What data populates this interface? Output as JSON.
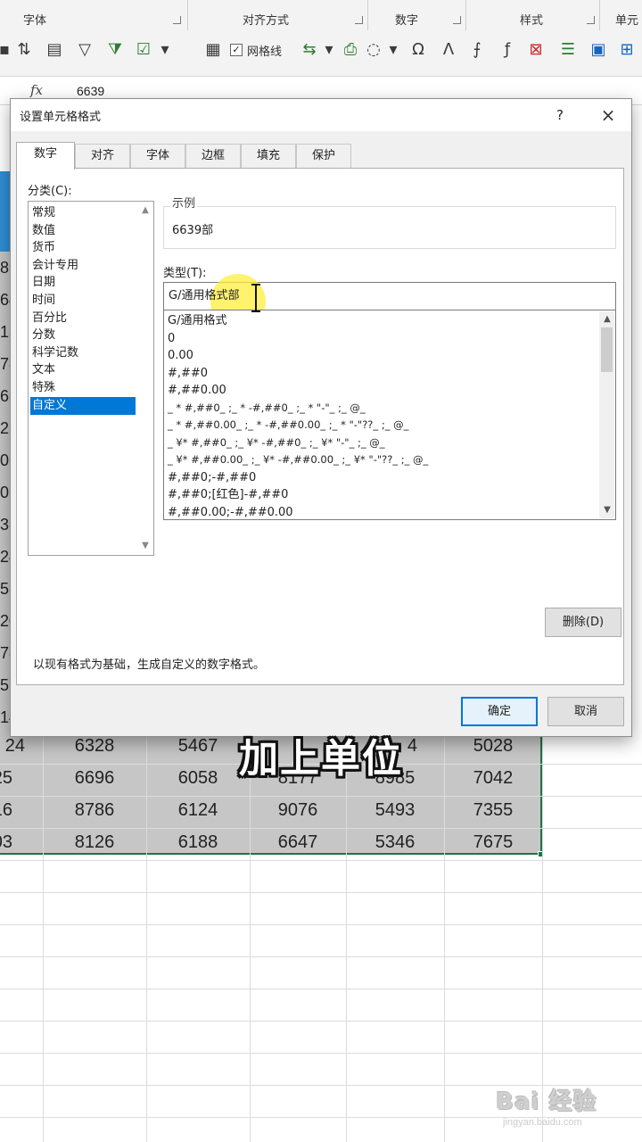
{
  "ribbon": {
    "groups": [
      {
        "label": "字体"
      },
      {
        "label": "对齐方式"
      },
      {
        "label": "数字"
      },
      {
        "label": "样式"
      },
      {
        "label": "单元"
      }
    ],
    "gridlines_label": "网格线",
    "gridlines_checked": true
  },
  "formula_bar": {
    "fx_label": "fx",
    "value": "6639"
  },
  "sheet": {
    "left_partial": [
      "89",
      "64",
      "15",
      "78",
      "68",
      "22",
      "06",
      "01",
      "38",
      "24",
      "53",
      "20",
      "78",
      "57",
      "14"
    ],
    "rows": [
      [
        "24",
        "6328",
        "5467",
        "9",
        "4",
        "5028"
      ],
      [
        "25",
        "6696",
        "6058",
        "8177",
        "8985",
        "7042"
      ],
      [
        "16",
        "8786",
        "6124",
        "9076",
        "5493",
        "7355"
      ],
      [
        "03",
        "8126",
        "6188",
        "6647",
        "5346",
        "7675"
      ]
    ],
    "header_band_text": "期"
  },
  "dialog": {
    "title": "设置单元格格式",
    "help": "?",
    "close": "×",
    "tabs": [
      "数字",
      "对齐",
      "字体",
      "边框",
      "填充",
      "保护"
    ],
    "active_tab": "数字",
    "category_label": "分类(C):",
    "categories": [
      "常规",
      "数值",
      "货币",
      "会计专用",
      "日期",
      "时间",
      "百分比",
      "分数",
      "科学记数",
      "文本",
      "特殊",
      "自定义"
    ],
    "selected_category": "自定义",
    "sample_label": "示例",
    "sample_value": "6639部",
    "type_label": "类型(T):",
    "type_value": "G/通用格式部",
    "formats": [
      "G/通用格式",
      "0",
      "0.00",
      "#,##0",
      "#,##0.00",
      "_ * #,##0_ ;_ * -#,##0_ ;_ * \"-\"_ ;_ @_",
      "_ * #,##0.00_ ;_ * -#,##0.00_ ;_ * \"-\"??_ ;_ @_",
      "_ ¥* #,##0_ ;_ ¥* -#,##0_ ;_ ¥* \"-\"_ ;_ @_",
      "_ ¥* #,##0.00_ ;_ ¥* -#,##0.00_ ;_ ¥* \"-\"??_ ;_ @_",
      "#,##0;-#,##0",
      "#,##0;[红色]-#,##0",
      "#,##0.00;-#,##0.00"
    ],
    "delete_label": "删除(D)",
    "description": "以现有格式为基础，生成自定义的数字格式。",
    "ok_label": "确定",
    "cancel_label": "取消"
  },
  "caption": "加上单位",
  "watermark": {
    "main": "Bai 经验",
    "sub": "jingyan.baidu.com"
  },
  "colors": {
    "accent": "#0078d7",
    "selection_border": "#217346",
    "selection_fill": "#c6c6c6",
    "highlight": "#ffee3c"
  }
}
